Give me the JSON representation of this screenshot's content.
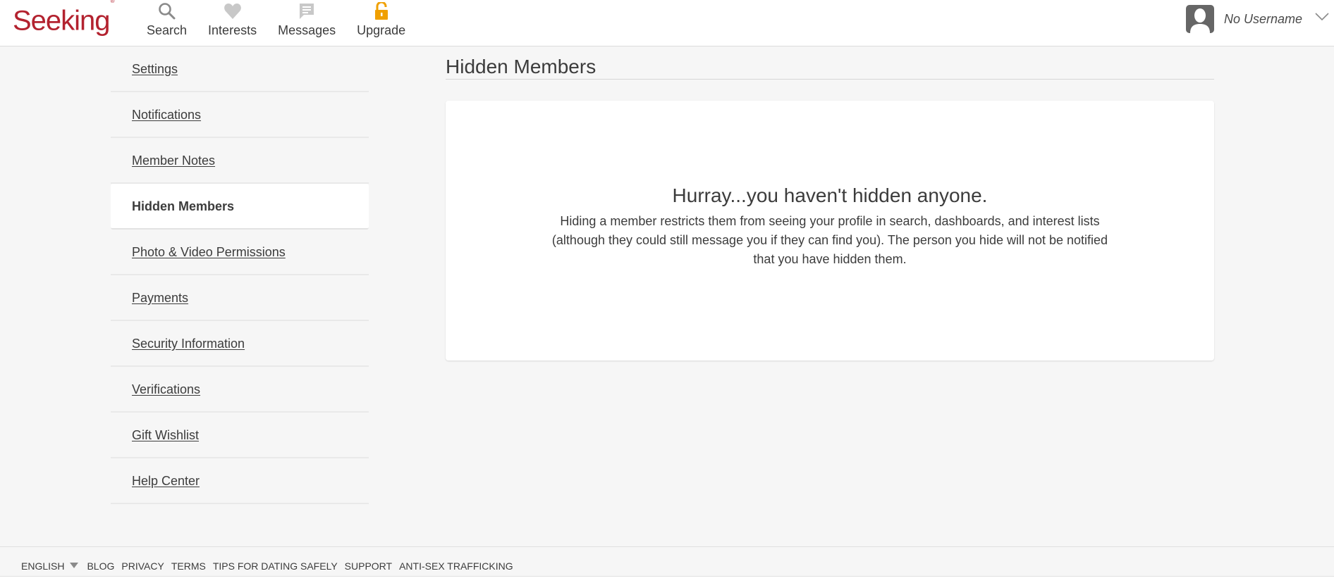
{
  "brand": {
    "name": "Seeking",
    "mark": "®",
    "color": "#b3222f"
  },
  "nav": [
    {
      "label": "Search",
      "icon": "search-icon"
    },
    {
      "label": "Interests",
      "icon": "heart-icon"
    },
    {
      "label": "Messages",
      "icon": "message-icon"
    },
    {
      "label": "Upgrade",
      "icon": "unlock-icon",
      "color": "#f0a000"
    }
  ],
  "user": {
    "name": "No Username",
    "avatar": "avatar-silhouette-icon"
  },
  "sidebar": {
    "items": [
      {
        "label": "Settings",
        "active": false
      },
      {
        "label": "Notifications",
        "active": false
      },
      {
        "label": "Member Notes",
        "active": false
      },
      {
        "label": "Hidden Members",
        "active": true
      },
      {
        "label": "Photo & Video Permissions",
        "active": false
      },
      {
        "label": "Payments",
        "active": false
      },
      {
        "label": "Security Information",
        "active": false
      },
      {
        "label": "Verifications",
        "active": false
      },
      {
        "label": "Gift Wishlist",
        "active": false
      },
      {
        "label": "Help Center",
        "active": false
      }
    ]
  },
  "main": {
    "title": "Hidden Members",
    "empty_heading": "Hurray...you haven't hidden anyone.",
    "empty_text": "Hiding a member restricts them from seeing your profile in search, dashboards, and interest lists (although they could still message you if they can find you). The person you hide will not be notified that you have hidden them."
  },
  "footer": {
    "language": "English",
    "links": [
      "Blog",
      "Privacy",
      "Terms",
      "Tips for Dating Safely",
      "Support",
      "Anti-Sex Trafficking"
    ]
  }
}
